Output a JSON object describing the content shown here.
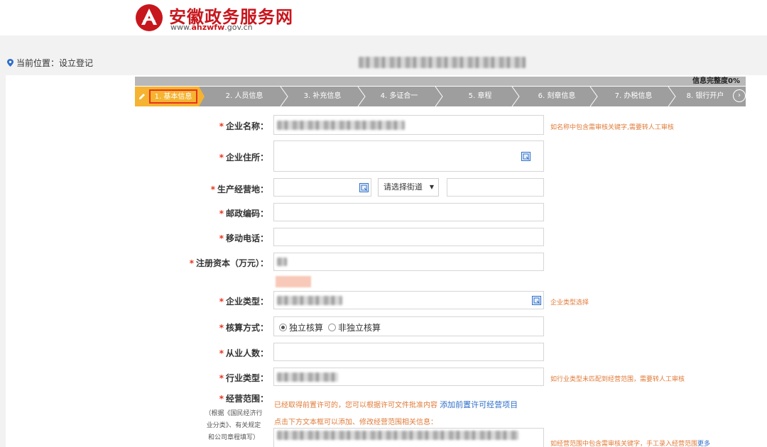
{
  "header": {
    "site_title": "安徽政务服务网",
    "url_prefix": "www.",
    "url_brand": "ahzwfw",
    "url_suffix": ".gov.cn",
    "brand_color": "#c8161d"
  },
  "location": {
    "text": "当前位置：设立登记"
  },
  "progress": {
    "label": "信息完整度0%",
    "percent": 0
  },
  "steps": [
    {
      "label": "1. 基本信息",
      "active": true
    },
    {
      "label": "2. 人员信息",
      "active": false
    },
    {
      "label": "3. 补充信息",
      "active": false
    },
    {
      "label": "4. 多证合一",
      "active": false
    },
    {
      "label": "5. 章程",
      "active": false
    },
    {
      "label": "6. 刻章信息",
      "active": false
    },
    {
      "label": "7. 办税信息",
      "active": false
    },
    {
      "label": "8. 银行开户",
      "active": false
    }
  ],
  "form": {
    "required_mark": "*",
    "company_name": {
      "label": "企业名称：",
      "hint": "如名称中包含需审核关键字,需要转人工审核"
    },
    "company_address": {
      "label": "企业住所："
    },
    "business_place": {
      "label": "生产经营地：",
      "street_select": "请选择街道"
    },
    "postal_code": {
      "label": "邮政编码："
    },
    "mobile": {
      "label": "移动电话："
    },
    "registered_capital": {
      "label": "注册资本（万元）："
    },
    "company_type": {
      "label": "企业类型：",
      "hint": "企业类型选择"
    },
    "accounting": {
      "label": "核算方式：",
      "options": [
        {
          "label": "独立核算",
          "checked": true
        },
        {
          "label": "非独立核算",
          "checked": false
        }
      ]
    },
    "employees": {
      "label": "从业人数："
    },
    "industry_type": {
      "label": "行业类型：",
      "hint": "如行业类型未匹配到经营范围，需要转人工审核"
    },
    "business_scope": {
      "label": "经营范围：",
      "note_line1": "（根据《国民经济行",
      "note_line2": "业分类》、有关规定",
      "note_line3": "和公司章程填写）",
      "permit_text": "已经取得前置许可的，您可以根据许可文件批准内容",
      "permit_link": "添加前置许可经营项目",
      "edit_text": "点击下方文本框可以添加、修改经营范围相关信息：",
      "hint": "如经营范围中包含需审核关键字，手工录入经营范围",
      "hint_more": "更多"
    }
  },
  "colors": {
    "accent_orange": "#f5b331",
    "required_red": "#e8331c",
    "hint_orange": "#e07b39",
    "link_blue": "#2f6fc9"
  }
}
